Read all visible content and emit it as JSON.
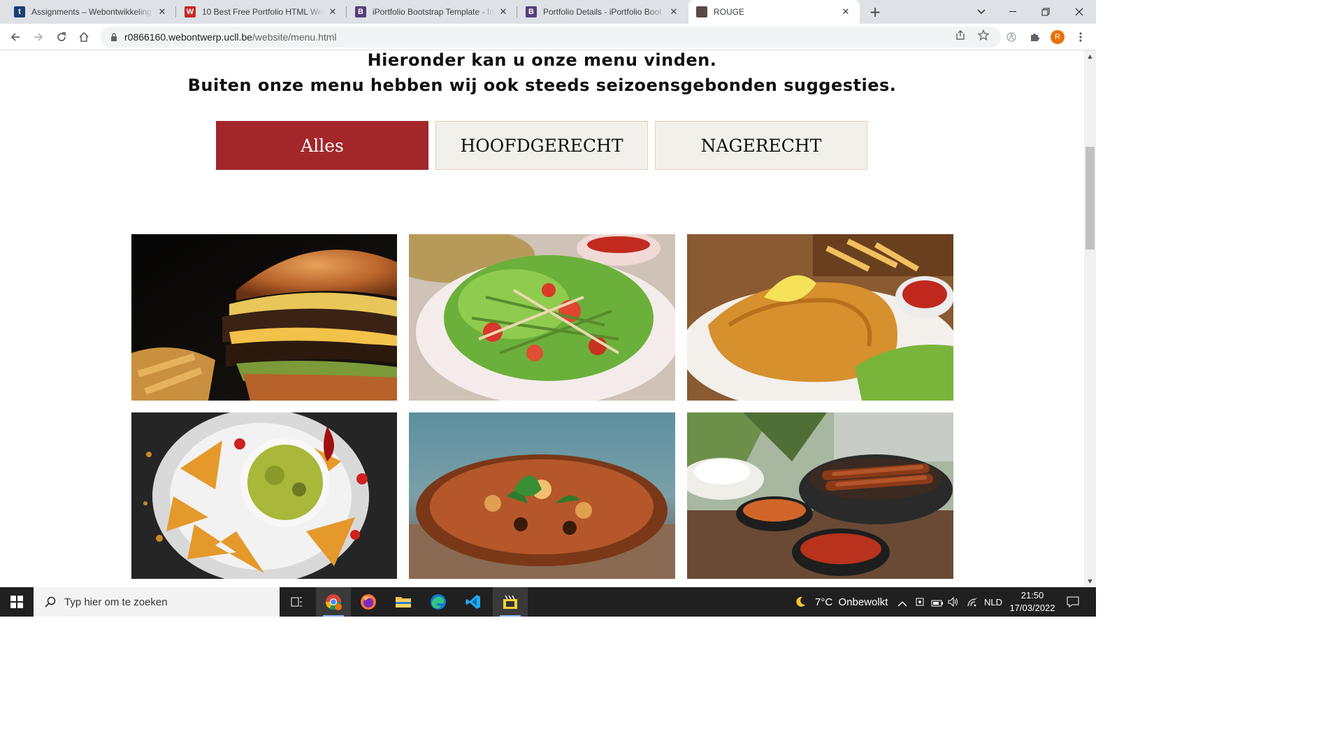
{
  "browser": {
    "tabs": [
      {
        "title": "Assignments – Webontwikkeling",
        "favicon_letter": "t",
        "favicon_color": "#1a3e72"
      },
      {
        "title": "10 Best Free Portfolio HTML Web",
        "favicon_letter": "W",
        "favicon_color": "#c62828"
      },
      {
        "title": "iPortfolio Bootstrap Template - In",
        "favicon_letter": "B",
        "favicon_color": "#563d7c"
      },
      {
        "title": "Portfolio Details - iPortfolio Boot",
        "favicon_letter": "B",
        "favicon_color": "#563d7c"
      },
      {
        "title": "ROUGE",
        "favicon_letter": "",
        "favicon_color": "#5a4a42"
      }
    ],
    "active_tab_index": 4,
    "url_host": "r0866160.webontwerp.ucll.be",
    "url_path": "/website/menu.html",
    "profile_initial": "R"
  },
  "page": {
    "intro_line1": "Hieronder kan u onze menu vinden.",
    "intro_line2": "Buiten onze menu hebben wij ook steeds seizoensgebonden suggesties.",
    "filters": [
      {
        "label": "Alles",
        "active": true
      },
      {
        "label": "HOOFDGERECHT",
        "active": false
      },
      {
        "label": "NAGERECHT",
        "active": false
      }
    ],
    "accent_color": "#a3262a",
    "menu_images": [
      {
        "subject": "burger"
      },
      {
        "subject": "salad"
      },
      {
        "subject": "schnitzel"
      },
      {
        "subject": "nachos-guacamole"
      },
      {
        "subject": "pizza"
      },
      {
        "subject": "grilled-skewers"
      }
    ]
  },
  "taskbar": {
    "search_placeholder": "Typ hier om te zoeken",
    "weather": "7°C  Onbewolkt",
    "language": "NLD",
    "time": "21:50",
    "date": "17/03/2022"
  }
}
